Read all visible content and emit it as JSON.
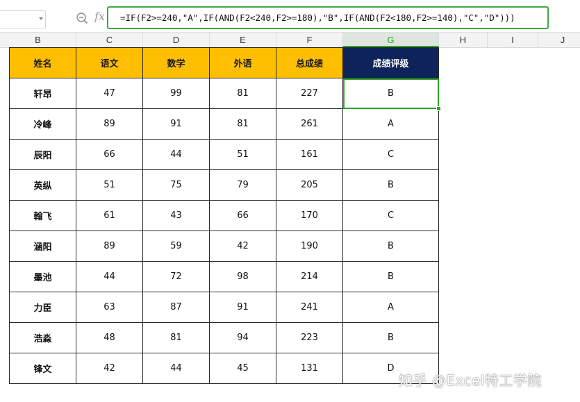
{
  "formula_bar": {
    "name_box_value": "",
    "fx_label": "fx",
    "formula": "=IF(F2>=240,\"A\",IF(AND(F2<240,F2>=180),\"B\",IF(AND(F2<180,F2>=140),\"C\",\"D\")))"
  },
  "columns": [
    "B",
    "C",
    "D",
    "E",
    "F",
    "G",
    "H",
    "I",
    "J"
  ],
  "selected_column": "G",
  "table": {
    "headers": [
      "姓名",
      "语文",
      "数学",
      "外语",
      "总成绩",
      "成绩评级"
    ],
    "rows": [
      [
        "轩昂",
        "47",
        "99",
        "81",
        "227",
        "B"
      ],
      [
        "冷峰",
        "89",
        "91",
        "81",
        "261",
        "A"
      ],
      [
        "辰阳",
        "66",
        "44",
        "51",
        "161",
        "C"
      ],
      [
        "英纵",
        "51",
        "75",
        "79",
        "205",
        "B"
      ],
      [
        "翰飞",
        "61",
        "43",
        "66",
        "170",
        "C"
      ],
      [
        "涵阳",
        "89",
        "59",
        "42",
        "190",
        "B"
      ],
      [
        "墨池",
        "44",
        "72",
        "98",
        "214",
        "B"
      ],
      [
        "力臣",
        "63",
        "87",
        "91",
        "241",
        "A"
      ],
      [
        "浩淼",
        "48",
        "81",
        "94",
        "223",
        "B"
      ],
      [
        "锋文",
        "42",
        "44",
        "45",
        "131",
        "D"
      ]
    ]
  },
  "colors": {
    "header_yellow": "#ffbe00",
    "header_dark": "#0d2359",
    "selection_green": "#2aa52a"
  },
  "watermark": "知乎 @Excel特工学院"
}
